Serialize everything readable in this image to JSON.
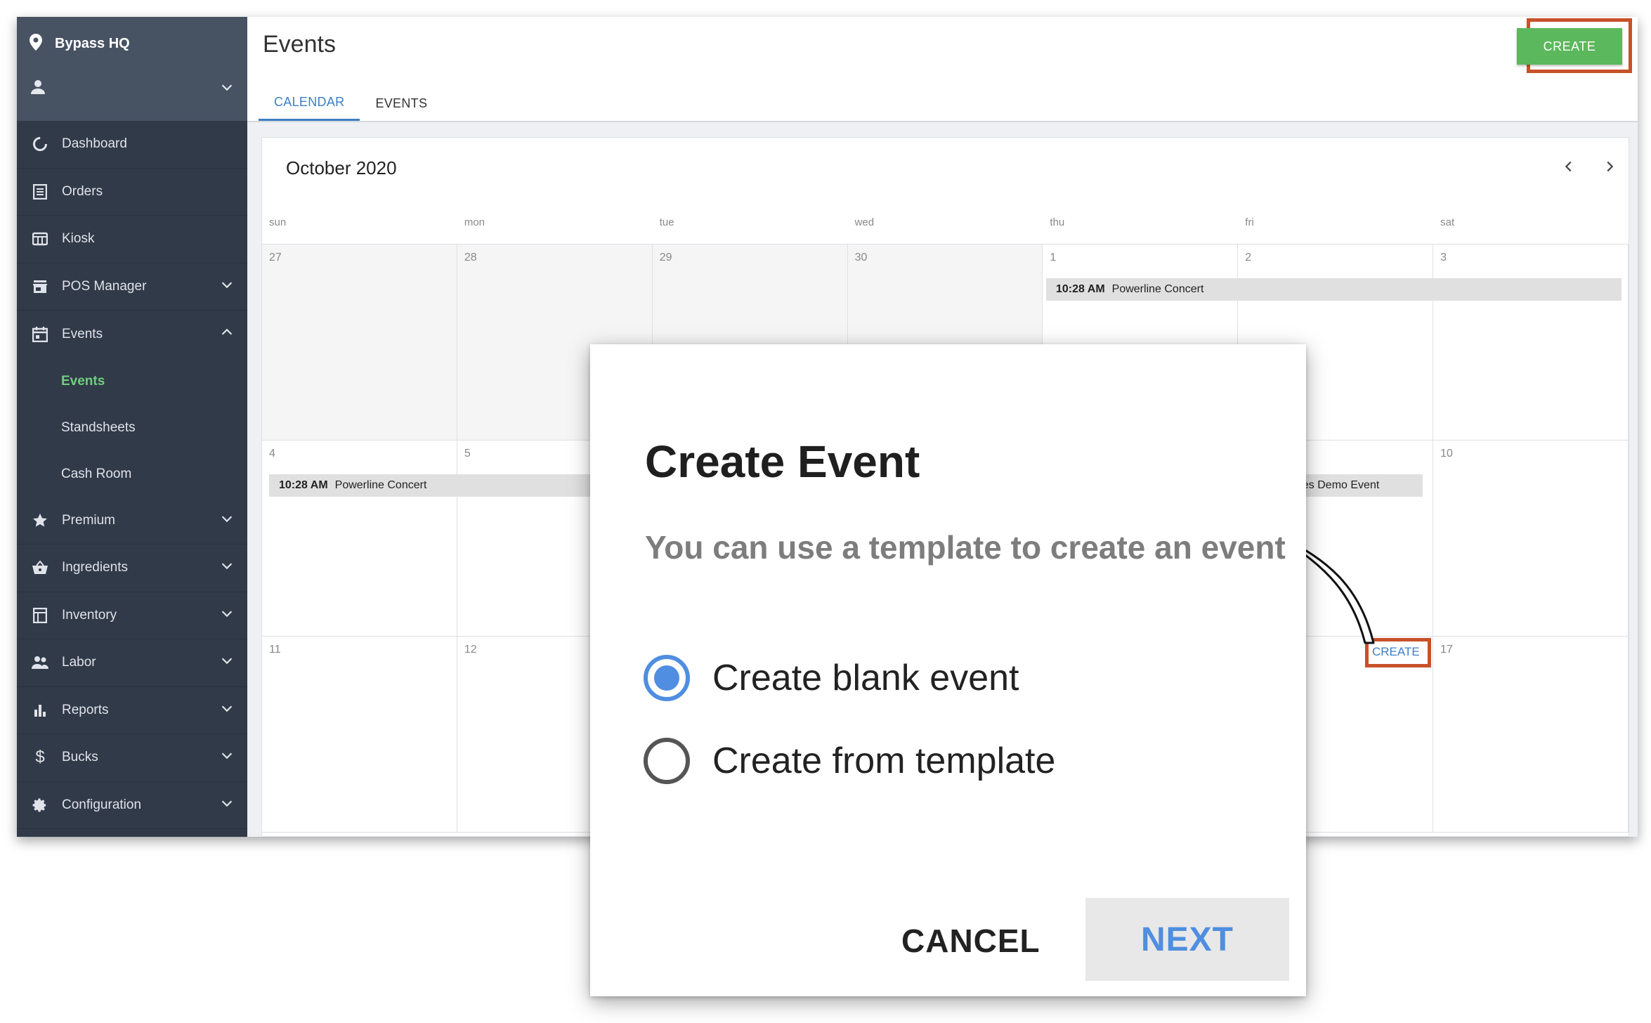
{
  "sidebar": {
    "venue": "Bypass HQ",
    "items": [
      {
        "label": "Dashboard",
        "icon": "dashboard-icon",
        "expandable": false
      },
      {
        "label": "Orders",
        "icon": "orders-icon",
        "expandable": false
      },
      {
        "label": "Kiosk",
        "icon": "kiosk-icon",
        "expandable": false
      },
      {
        "label": "POS Manager",
        "icon": "store-icon",
        "expandable": true
      },
      {
        "label": "Events",
        "icon": "calendar-icon",
        "expandable": true,
        "expanded": true
      },
      {
        "label": "Premium",
        "icon": "star-icon",
        "expandable": true
      },
      {
        "label": "Ingredients",
        "icon": "basket-icon",
        "expandable": true
      },
      {
        "label": "Inventory",
        "icon": "inventory-icon",
        "expandable": true
      },
      {
        "label": "Labor",
        "icon": "people-icon",
        "expandable": true
      },
      {
        "label": "Reports",
        "icon": "bar-chart-icon",
        "expandable": true
      },
      {
        "label": "Bucks",
        "icon": "dollar-icon",
        "expandable": true
      },
      {
        "label": "Configuration",
        "icon": "gear-icon",
        "expandable": true
      }
    ],
    "events_sub": [
      "Events",
      "Standsheets",
      "Cash Room"
    ]
  },
  "header": {
    "title": "Events",
    "create_label": "CREATE",
    "tabs": [
      "CALENDAR",
      "EVENTS"
    ]
  },
  "calendar": {
    "month": "October 2020",
    "weekdays": [
      "sun",
      "mon",
      "tue",
      "wed",
      "thu",
      "fri",
      "sat"
    ],
    "week1": [
      "27",
      "28",
      "29",
      "30",
      "1",
      "2",
      "3"
    ],
    "week2": [
      "4",
      "5",
      "",
      "",
      "",
      "",
      "10"
    ],
    "week3": [
      "11",
      "12",
      "",
      "",
      "",
      "",
      "17"
    ],
    "event1": {
      "time": "10:28 AM",
      "name": "Powerline Concert"
    },
    "event2": {
      "time": "10:28 AM",
      "name": "Powerline Concert"
    },
    "event3_partial": "uites Demo Event",
    "cell_create": "CREATE"
  },
  "dialog": {
    "title": "Create Event",
    "subtitle": "You can use a template to create an event",
    "option_blank": "Create blank event",
    "option_template": "Create from template",
    "selected": "blank",
    "cancel": "CANCEL",
    "next": "NEXT"
  },
  "colors": {
    "accent_blue": "#3c7fc4",
    "create_green": "#5cb85c",
    "highlight_orange": "#c8512a",
    "sidebar_bg": "#313a48"
  }
}
